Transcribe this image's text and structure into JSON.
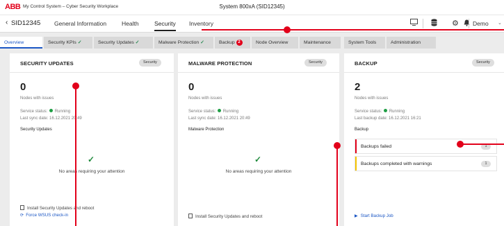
{
  "app": {
    "logo": "ABB",
    "breadcrumb": "My Control System – Cyber Security Workplace",
    "system_title": "System 800xA (SID12345)"
  },
  "nav": {
    "back_icon": "chevron-left-icon",
    "system": "SID12345",
    "tabs": [
      "General Information",
      "Health",
      "Security",
      "Inventory"
    ],
    "active_tab": "Security",
    "user": "Demo"
  },
  "subtabs": [
    {
      "label": "Overview",
      "active": true,
      "check": false,
      "badge": ""
    },
    {
      "label": "Security KPIs",
      "active": false,
      "check": true,
      "badge": ""
    },
    {
      "label": "Security Updates",
      "active": false,
      "check": true,
      "badge": ""
    },
    {
      "label": "Malware Protection",
      "active": false,
      "check": true,
      "badge": ""
    },
    {
      "label": "Backup",
      "active": false,
      "check": false,
      "badge": "2"
    },
    {
      "label": "Node Overview",
      "active": false,
      "check": false,
      "badge": ""
    },
    {
      "label": "Maintenance",
      "active": false,
      "check": false,
      "badge": ""
    },
    {
      "label": "System Tools",
      "active": false,
      "check": false,
      "badge": ""
    },
    {
      "label": "Administration",
      "active": false,
      "check": false,
      "badge": ""
    }
  ],
  "panels": {
    "updates": {
      "title": "SECURITY UPDATES",
      "badge": "Security",
      "count": "0",
      "count_label": "Nodes with issues",
      "service_label": "Service status:",
      "service_value": "Running",
      "sync": "Last sync date: 16.12.2021 20:49",
      "section": "Security Updates",
      "ok_message": "No areas requiring your attention",
      "action1": "Install Security Updates and reboot",
      "action2": "Force WSUS check-in"
    },
    "malware": {
      "title": "MALWARE PROTECTION",
      "badge": "Security",
      "count": "0",
      "count_label": "Nodes with issues",
      "service_label": "Service status:",
      "service_value": "Running",
      "sync": "Last sync date: 16.12.2021 20:49",
      "section": "Malware Protection",
      "ok_message": "No areas requiring your attention",
      "action1": "Install Security Updates and reboot"
    },
    "backup": {
      "title": "BACKUP",
      "badge": "Security",
      "count": "2",
      "count_label": "Nodes with issues",
      "service_label": "Service status:",
      "service_value": "Running",
      "sync": "Last backup date: 16.12.2021 16:21",
      "section": "Backup",
      "rows": [
        {
          "label": "Backups failed",
          "count": "1",
          "color": "#e2001a"
        },
        {
          "label": "Backups completed with warnings",
          "count": "1",
          "color": "#f5c400"
        }
      ],
      "action": "Start Backup Job"
    }
  },
  "colors": {
    "accent": "#1a56c4",
    "brand": "#e2001a",
    "ok": "#1e9e44",
    "warning": "#f5c400"
  }
}
